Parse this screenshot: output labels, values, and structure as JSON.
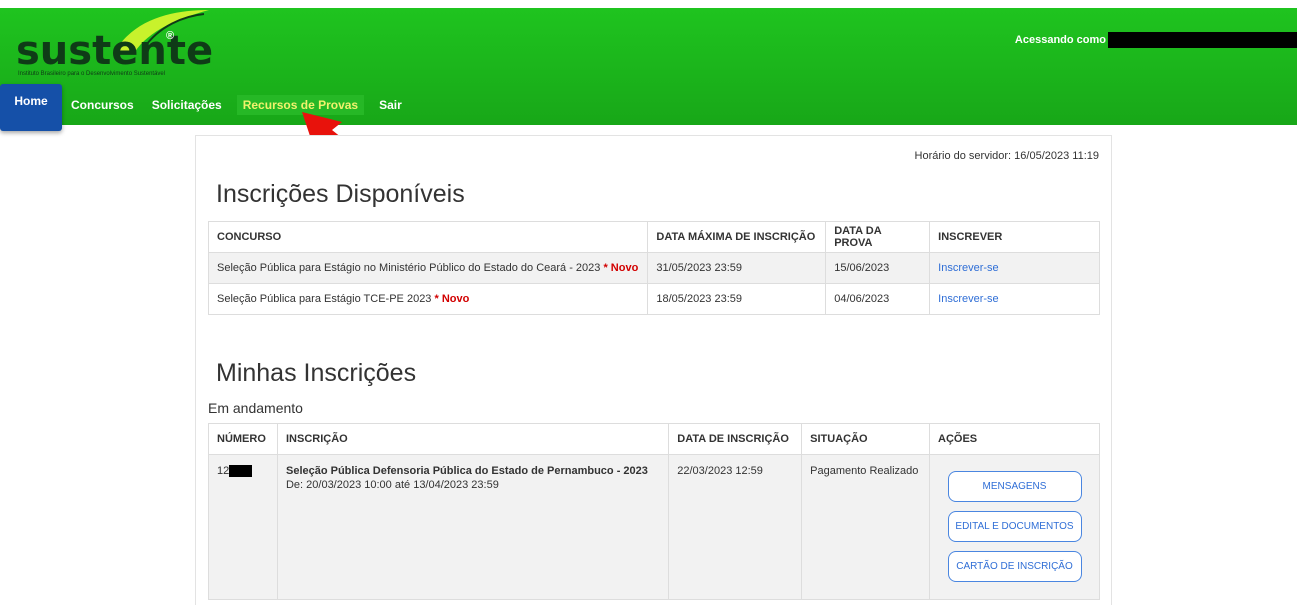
{
  "header": {
    "logo_text": "sustente",
    "logo_reg": "®",
    "logo_tagline": "Instituto Brasileiro para o Desenvolvimento Sustentável",
    "user_label": "Acessando como"
  },
  "nav": {
    "items": [
      {
        "label": "Home"
      },
      {
        "label": "Concursos"
      },
      {
        "label": "Solicitações"
      },
      {
        "label": "Recursos de Provas"
      },
      {
        "label": "Sair"
      }
    ]
  },
  "server_time": "Horário do servidor: 16/05/2023 11:19",
  "disponiveis": {
    "title": "Inscrições Disponíveis",
    "headers": [
      "CONCURSO",
      "DATA MÁXIMA DE INSCRIÇÃO",
      "DATA DA PROVA",
      "INSCREVER"
    ],
    "rows": [
      {
        "concurso": "Seleção Pública para Estágio no Ministério Público do Estado do Ceará - 2023",
        "novo": "* Novo",
        "data_max": "31/05/2023 23:59",
        "data_prova": "15/06/2023",
        "inscrever": "Inscrever-se"
      },
      {
        "concurso": "Seleção Pública para Estágio TCE-PE 2023",
        "novo": "* Novo",
        "data_max": "18/05/2023 23:59",
        "data_prova": "04/06/2023",
        "inscrever": "Inscrever-se"
      }
    ]
  },
  "minhas": {
    "title": "Minhas Inscrições",
    "subtitle": "Em andamento",
    "headers": [
      "NÚMERO",
      "INSCRIÇÃO",
      "DATA DE INSCRIÇÃO",
      "SITUAÇÃO",
      "AÇÕES"
    ],
    "rows": [
      {
        "numero_prefix": "12",
        "inscricao": "Seleção Pública Defensoria Pública do Estado de Pernambuco - 2023",
        "periodo": "De: 20/03/2023 10:00 até 13/04/2023 23:59",
        "data_inscricao": "22/03/2023 12:59",
        "situacao": "Pagamento Realizado",
        "acoes": [
          "MENSAGENS",
          "EDITAL E DOCUMENTOS",
          "CARTÃO DE INSCRIÇÃO"
        ]
      }
    ]
  },
  "colors": {
    "header_green": "#1fc41f",
    "home_blue": "#1550a8",
    "recursos_yellow": "#f1f26c",
    "arrow_red": "#e8120c",
    "novo_red": "#d20000",
    "link_blue": "#2f6ed6"
  }
}
